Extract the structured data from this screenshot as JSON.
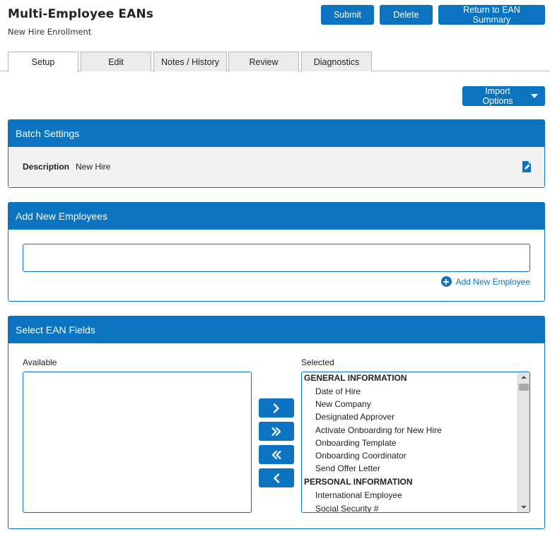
{
  "header": {
    "title": "Multi-Employee EANs",
    "subtitle": "New Hire Enrollment",
    "submit_label": "Submit",
    "delete_label": "Delete",
    "return_label": "Return to EAN Summary"
  },
  "tabs": [
    {
      "label": "Setup",
      "active": true
    },
    {
      "label": "Edit",
      "active": false
    },
    {
      "label": "Notes / History",
      "active": false
    },
    {
      "label": "Review",
      "active": false
    },
    {
      "label": "Diagnostics",
      "active": false
    }
  ],
  "import_options_label": "Import Options",
  "batch_settings": {
    "heading": "Batch Settings",
    "description_label": "Description",
    "description_value": "New Hire"
  },
  "add_employees": {
    "heading": "Add New Employees",
    "input_value": "",
    "add_link_label": "Add New Employee"
  },
  "ean_fields": {
    "heading": "Select EAN Fields",
    "available_label": "Available",
    "selected_label": "Selected",
    "selected_groups": [
      {
        "name": "GENERAL INFORMATION",
        "items": [
          "Date of Hire",
          "New Company",
          "Designated Approver",
          "Activate Onboarding for New Hire",
          "Onboarding Template",
          "Onboarding Coordinator",
          "Send Offer Letter"
        ]
      },
      {
        "name": "PERSONAL INFORMATION",
        "items": [
          "International Employee",
          "Social Security #"
        ]
      }
    ]
  },
  "colors": {
    "primary": "#0b73c0",
    "panel_body": "#f1f1f1",
    "tab_inactive": "#ececec"
  },
  "icons": [
    "edit-document-icon",
    "plus-circle-icon",
    "chevron-right-icon",
    "double-chevron-right-icon",
    "double-chevron-left-icon",
    "chevron-left-icon",
    "caret-down-icon"
  ]
}
